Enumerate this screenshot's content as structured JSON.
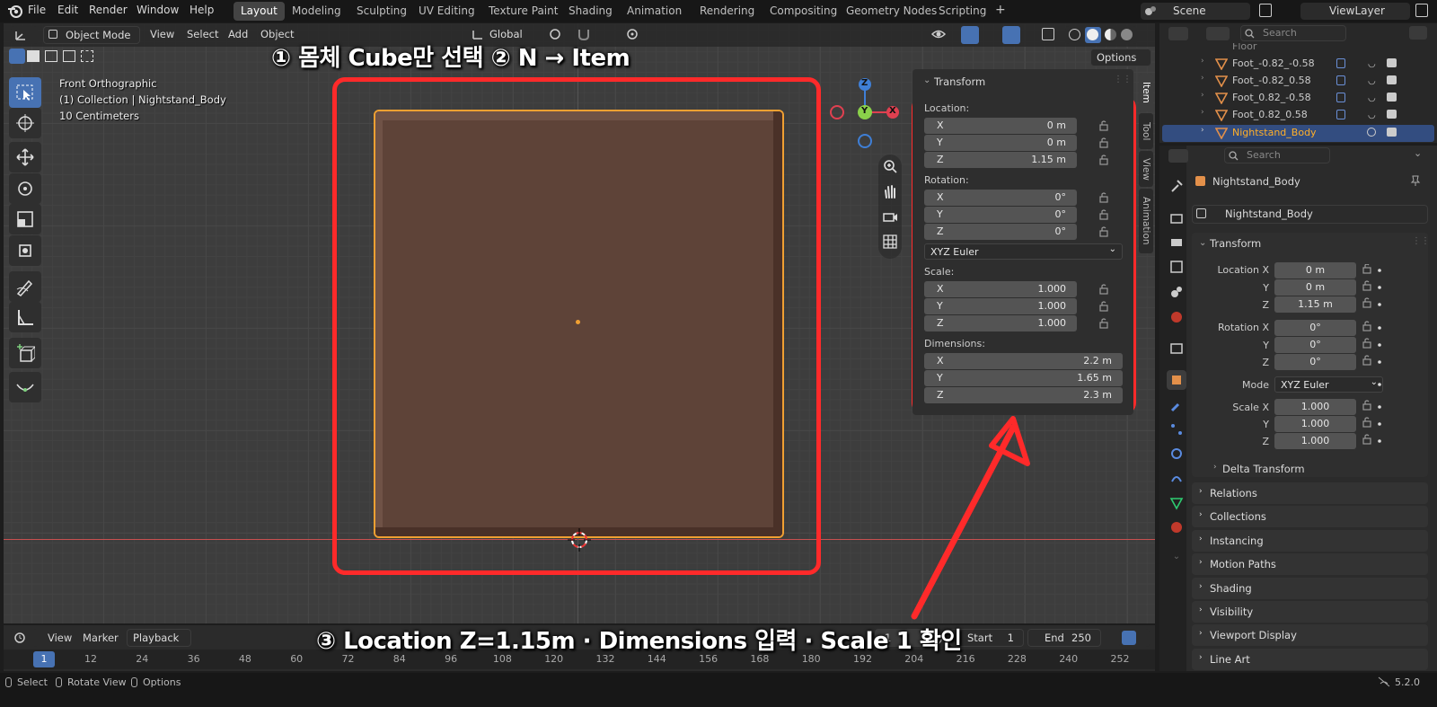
{
  "menu": [
    "File",
    "Edit",
    "Render",
    "Window",
    "Help"
  ],
  "workspaces": [
    "Layout",
    "Modeling",
    "Sculpting",
    "UV Editing",
    "Texture Paint",
    "Shading",
    "Animation",
    "Rendering",
    "Compositing",
    "Geometry Nodes",
    "Scripting"
  ],
  "scene": "Scene",
  "view_layer": "ViewLayer",
  "vp_header": {
    "mode": "Object Mode",
    "view": "View",
    "select": "Select",
    "add": "Add",
    "object": "Object",
    "orientation": "Global",
    "options": "Options"
  },
  "overlay_info": {
    "view_name": "Front Orthographic",
    "collection": "(1) Collection | Nightstand_Body",
    "scale": "10 Centimeters"
  },
  "annotations": {
    "top": "① 몸체 Cube만 선택  ② N → Item",
    "bottom": "③ Location Z=1.15m · Dimensions 입력 · Scale 1 확인"
  },
  "gizmo": {
    "z": "Z",
    "y": "Y",
    "x": "X"
  },
  "npanel": {
    "title": "Transform",
    "location_label": "Location:",
    "location": [
      {
        "axis": "X",
        "value": "0 m"
      },
      {
        "axis": "Y",
        "value": "0 m"
      },
      {
        "axis": "Z",
        "value": "1.15 m"
      }
    ],
    "rotation_label": "Rotation:",
    "rotation": [
      {
        "axis": "X",
        "value": "0°"
      },
      {
        "axis": "Y",
        "value": "0°"
      },
      {
        "axis": "Z",
        "value": "0°"
      }
    ],
    "rotation_mode": "XYZ Euler",
    "scale_label": "Scale:",
    "scale": [
      {
        "axis": "X",
        "value": "1.000"
      },
      {
        "axis": "Y",
        "value": "1.000"
      },
      {
        "axis": "Z",
        "value": "1.000"
      }
    ],
    "dimensions_label": "Dimensions:",
    "dimensions": [
      {
        "axis": "X",
        "value": "2.2 m"
      },
      {
        "axis": "Y",
        "value": "1.65 m"
      },
      {
        "axis": "Z",
        "value": "2.3 m"
      }
    ]
  },
  "side_tabs": [
    "Item",
    "Tool",
    "View",
    "Animation"
  ],
  "timeline": {
    "view": "View",
    "marker": "Marker",
    "playback": "Playback",
    "current_frame": "1",
    "start_label": "Start",
    "start": "1",
    "end_label": "End",
    "end": "250",
    "ruler": [
      "1",
      "12",
      "24",
      "36",
      "48",
      "60",
      "72",
      "84",
      "96",
      "108",
      "120",
      "132",
      "144",
      "156",
      "168",
      "180",
      "192",
      "204",
      "216",
      "228",
      "240",
      "252"
    ]
  },
  "status": {
    "select": "Select",
    "rotate": "Rotate View",
    "options": "Options",
    "version": "5.2.0"
  },
  "outliner": {
    "search": "Search",
    "rows": [
      "Floor",
      "Foot_-0.82_-0.58",
      "Foot_-0.82_0.58",
      "Foot_0.82_-0.58",
      "Foot_0.82_0.58",
      "Nightstand_Body"
    ]
  },
  "properties": {
    "search": "Search",
    "object_name": "Nightstand_Body",
    "object_field": "Nightstand_Body",
    "transform_title": "Transform",
    "location_x_label": "Location X",
    "y_label": "Y",
    "z_label": "Z",
    "loc": [
      "0 m",
      "0 m",
      "1.15 m"
    ],
    "rotation_x_label": "Rotation X",
    "rot": [
      "0°",
      "0°",
      "0°"
    ],
    "mode_label": "Mode",
    "mode": "XYZ Euler",
    "scale_x_label": "Scale X",
    "scl": [
      "1.000",
      "1.000",
      "1.000"
    ],
    "delta": "Delta Transform",
    "sections": [
      "Relations",
      "Collections",
      "Instancing",
      "Motion Paths",
      "Shading",
      "Visibility",
      "Viewport Display",
      "Line Art"
    ]
  },
  "colors": {
    "accent": "#4772b3",
    "cube": "#5e4338",
    "selection": "#f0a032",
    "annotation_red": "#ff2a2a",
    "selected_row_text": "#ffaf29"
  }
}
